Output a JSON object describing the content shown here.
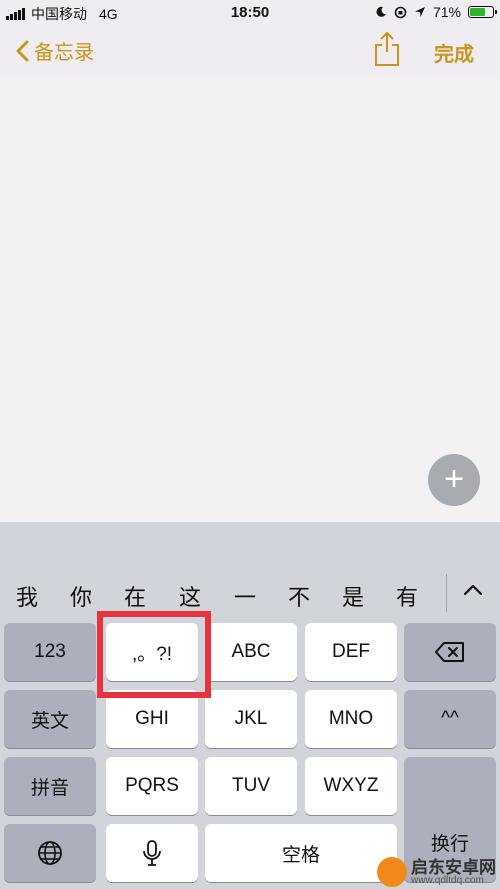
{
  "status_bar": {
    "carrier": "中国移动",
    "network": "4G",
    "time": "18:50",
    "battery": "71%",
    "battery_level": 0.71,
    "battery_color": "#2ab52a"
  },
  "nav": {
    "back_label": "备忘录",
    "done_label": "完成",
    "accent_color": "#c8961c"
  },
  "fab": {
    "label": "+"
  },
  "candidates": [
    "我",
    "你",
    "在",
    "这",
    "一",
    "不",
    "是",
    "有"
  ],
  "keys": {
    "numbers": "123",
    "punct": ",。?!",
    "abc": "ABC",
    "def": "DEF",
    "english": "英文",
    "ghi": "GHI",
    "jkl": "JKL",
    "mno": "MNO",
    "emoticon": "^^",
    "pinyin": "拼音",
    "pqrs": "PQRS",
    "tuv": "TUV",
    "wxyz": "WXYZ",
    "return": "换行",
    "space": "空格"
  },
  "watermark": {
    "title": "启东安卓网",
    "url": "www.qdltdq.com"
  }
}
